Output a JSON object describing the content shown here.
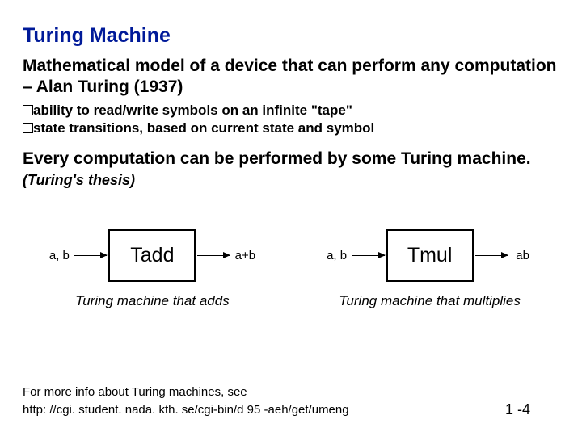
{
  "title": "Turing Machine",
  "subtitle": "Mathematical model of a device that can perform any computation – Alan Turing (1937)",
  "bullets": [
    "ability to read/write symbols on an infinite \"tape\"",
    "state transitions, based on current state and symbol"
  ],
  "statement_main": "Every computation can be performed by some Turing machine.",
  "statement_aside": "(Turing's thesis)",
  "diagrams": [
    {
      "input": "a, b",
      "box": "Tadd",
      "output": "a+b",
      "caption": "Turing machine that adds"
    },
    {
      "input": "a, b",
      "box": "Tmul",
      "output": "ab",
      "caption": "Turing machine that multiplies"
    }
  ],
  "footer_line1": "For more info about Turing machines, see",
  "footer_line2": "http: //cgi. student. nada. kth. se/cgi-bin/d 95 -aeh/get/umeng",
  "slide_number": "1 -4"
}
